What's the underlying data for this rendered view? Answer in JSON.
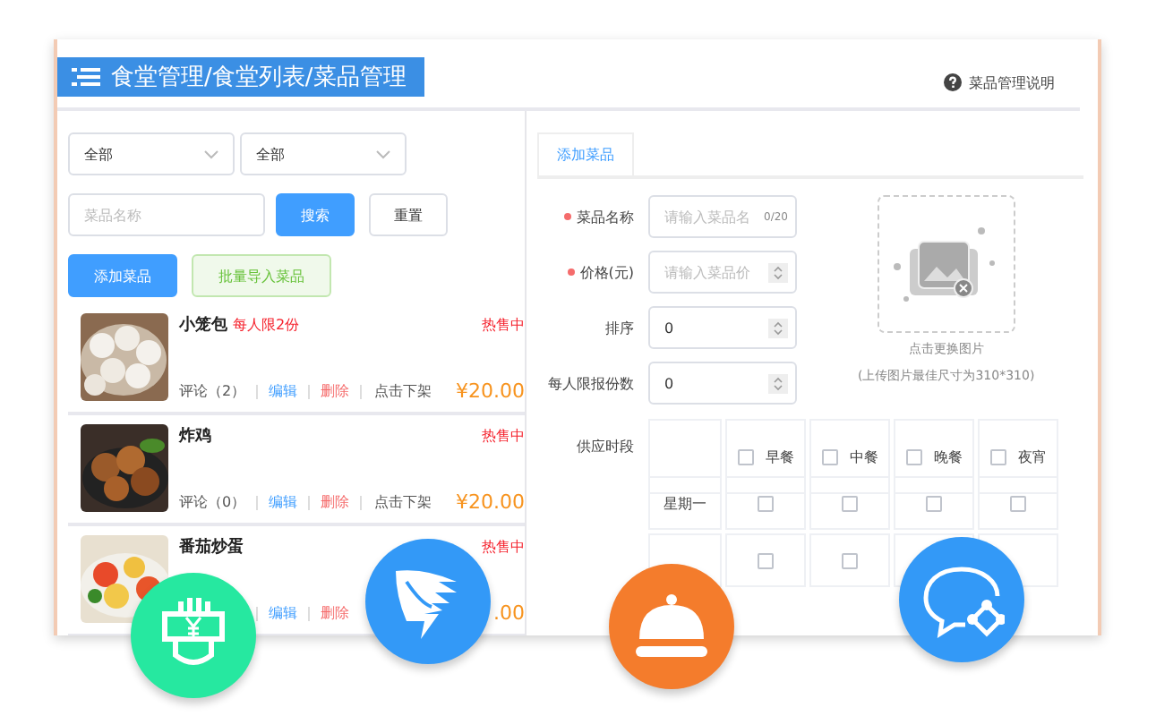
{
  "header": {
    "title": "食堂管理/食堂列表/菜品管理",
    "help": "菜品管理说明"
  },
  "filters": {
    "selects": [
      {
        "value": "全部"
      },
      {
        "value": "全部"
      }
    ],
    "search": {
      "placeholder": "菜品名称"
    },
    "search_button": "搜索",
    "reset_button": "重置",
    "add_button": "添加菜品",
    "import_button": "批量导入菜品"
  },
  "dishes": [
    {
      "name": "小笼包",
      "limit": "每人限2份",
      "status": "热售中",
      "comments": "评论（2）",
      "edit": "编辑",
      "delete": "删除",
      "offshelf": "点击下架",
      "price": "¥20.00",
      "kind": "picture"
    },
    {
      "name": "炸鸡",
      "status": "热售中",
      "comments": "评论（0）",
      "edit": "编辑",
      "delete": "删除",
      "offshelf": "点击下架",
      "price": "¥20.00",
      "kind": "picture"
    },
    {
      "name": "番茄炒蛋",
      "status": "热售中",
      "edit": "编辑",
      "delete": "删除",
      "price": ".00",
      "kind": "picture"
    }
  ],
  "form": {
    "tabs": [
      {
        "label": "添加菜品",
        "selected": true
      }
    ],
    "fields": [
      {
        "label": "菜品名称",
        "required": true,
        "placeholder": "请输入菜品名",
        "counter": "0/20",
        "kind": "text"
      },
      {
        "label": "价格(元)",
        "required": true,
        "placeholder": "请输入菜品价",
        "kind": "number"
      },
      {
        "label": "排序",
        "required": false,
        "value": "0",
        "kind": "number"
      },
      {
        "label": "每人限报份数",
        "required": false,
        "value": "0",
        "kind": "number"
      }
    ],
    "upload": {
      "caption": "点击更换图片",
      "hint": "(上传图片最佳尺寸为310*310)"
    },
    "supply": {
      "label": "供应时段",
      "meals": [
        {
          "label": "早餐",
          "checked": false
        },
        {
          "label": "中餐",
          "checked": false
        },
        {
          "label": "晚餐",
          "checked": false
        },
        {
          "label": "夜宵",
          "checked": false
        }
      ],
      "rows": [
        {
          "day": "星期一",
          "checked": [
            false,
            false,
            false,
            false
          ]
        },
        {
          "checked": [
            false,
            false
          ]
        }
      ]
    }
  },
  "badges": [
    {
      "kind": "cash",
      "color": "#26e8a0"
    },
    {
      "kind": "wing",
      "color": "#3399f7"
    },
    {
      "kind": "cloche",
      "color": "#f47c2c"
    },
    {
      "kind": "chat",
      "color": "#3399f7"
    }
  ]
}
